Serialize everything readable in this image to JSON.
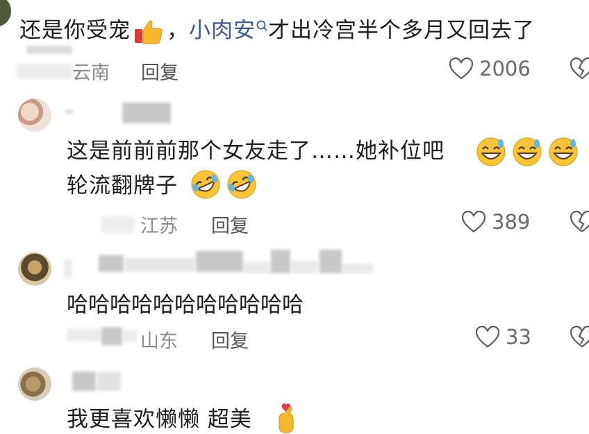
{
  "comments": [
    {
      "text_before": "还是你受宠",
      "text_mention": "小肉安",
      "text_after": "才出冷宫半个多月又回去了",
      "location": "云南",
      "reply_label": "回复",
      "like_count": "2006"
    },
    {
      "text_line1": "这是前前前那个女友走了……她补位吧",
      "text_line2": "轮流翻牌子",
      "location": "江苏",
      "reply_label": "回复",
      "like_count": "389"
    },
    {
      "text": "哈哈哈哈哈哈哈哈哈哈哈",
      "location": "山东",
      "reply_label": "回复",
      "like_count": "33"
    },
    {
      "text": "我更喜欢懒懒 超美"
    }
  ],
  "colors": {
    "mention": "#3a5a96",
    "meta_text": "#8a8a8a",
    "background": "#ffffff"
  },
  "icons": [
    "thumbs-up-emoji",
    "search-icon",
    "heart-icon",
    "dislike-heart-icon",
    "grinning-sweat-emoji",
    "rolling-laughing-emoji",
    "finger-heart-emoji"
  ]
}
